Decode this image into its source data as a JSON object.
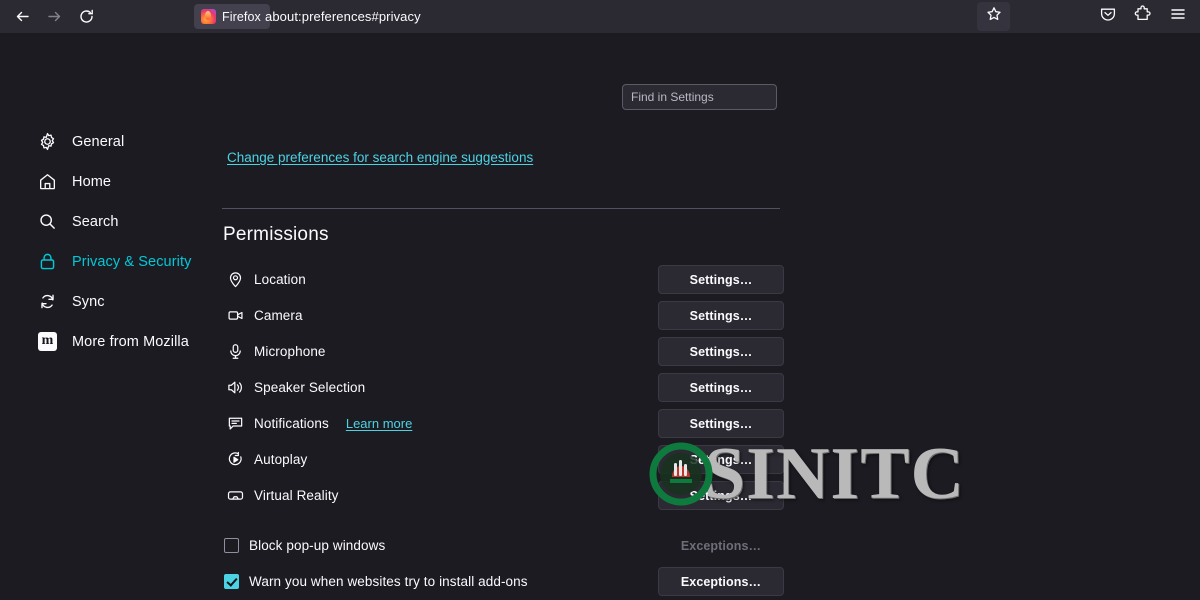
{
  "colors": {
    "chrome_bg": "#2b2a33",
    "page_bg": "#1c1b22",
    "accent": "#4cd3e3",
    "active_nav": "#00c8d7",
    "text": "#fbfbfe",
    "disabled_text": "#6e6d78",
    "watermark": "#b9b9b9",
    "logo_green": "#0f7a3d"
  },
  "chrome": {
    "back_icon": "back-arrow-icon",
    "forward_icon": "forward-arrow-icon",
    "reload_icon": "reload-icon",
    "tab_label": "Firefox",
    "url": "about:preferences#privacy",
    "bookmark_icon": "star-icon",
    "pocket_icon": "pocket-icon",
    "extensions_icon": "extensions-icon",
    "menu_icon": "hamburger-menu-icon"
  },
  "search": {
    "placeholder": "Find in Settings",
    "value": ""
  },
  "sidebar": {
    "items": [
      {
        "label": "General",
        "icon": "gear-icon",
        "active": false
      },
      {
        "label": "Home",
        "icon": "home-icon",
        "active": false
      },
      {
        "label": "Search",
        "icon": "search-icon",
        "active": false
      },
      {
        "label": "Privacy & Security",
        "icon": "lock-icon",
        "active": true
      },
      {
        "label": "Sync",
        "icon": "sync-icon",
        "active": false
      },
      {
        "label": "More from Mozilla",
        "icon": "mozilla-icon",
        "active": false
      }
    ]
  },
  "main": {
    "preferences_link": "Change preferences for search engine suggestions",
    "section_title": "Permissions",
    "permissions": [
      {
        "label": "Location",
        "icon": "location-pin-icon",
        "button": "Settings…",
        "disabled": false,
        "learn_more": null
      },
      {
        "label": "Camera",
        "icon": "camera-icon",
        "button": "Settings…",
        "disabled": false,
        "learn_more": null
      },
      {
        "label": "Microphone",
        "icon": "microphone-icon",
        "button": "Settings…",
        "disabled": false,
        "learn_more": null
      },
      {
        "label": "Speaker Selection",
        "icon": "speaker-icon",
        "button": "Settings…",
        "disabled": false,
        "learn_more": null
      },
      {
        "label": "Notifications",
        "icon": "notification-bubble-icon",
        "button": "Settings…",
        "disabled": false,
        "learn_more": "Learn more"
      },
      {
        "label": "Autoplay",
        "icon": "autoplay-icon",
        "button": "Settings…",
        "disabled": false,
        "learn_more": null
      },
      {
        "label": "Virtual Reality",
        "icon": "vr-headset-icon",
        "button": "Settings…",
        "disabled": false,
        "learn_more": null
      }
    ],
    "checkboxes": [
      {
        "label": "Block pop-up windows",
        "checked": false,
        "button": "Exceptions…",
        "button_disabled": true
      },
      {
        "label": "Warn you when websites try to install add-ons",
        "checked": true,
        "button": "Exceptions…",
        "button_disabled": false
      }
    ]
  },
  "watermark": {
    "text": "SINITC",
    "logo_icon": "sinitc-logo-icon"
  }
}
